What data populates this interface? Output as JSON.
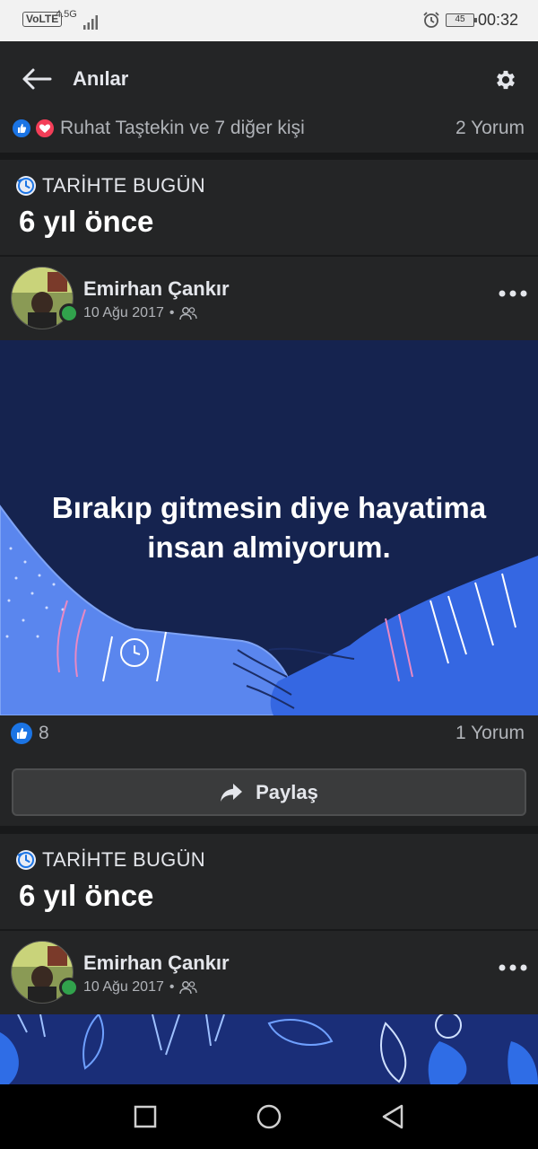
{
  "status_bar": {
    "volte": "VoLTE",
    "network": "4.5G",
    "battery": "45",
    "time": "00:32"
  },
  "header": {
    "title": "Anılar"
  },
  "summary": {
    "reactors": "Ruhat Taştekin ve 7 diğer kişi",
    "comments": "2 Yorum"
  },
  "memories": [
    {
      "section_label": "TARİHTE BUGÜN",
      "years_ago": "6 yıl önce",
      "author": "Emirhan Çankır",
      "date": "10 Ağu 2017",
      "separator": "•",
      "post_text": "Bırakıp gitmesin diye hayatima insan almiyorum.",
      "likes": "8",
      "comments": "1 Yorum",
      "share_label": "Paylaş"
    },
    {
      "section_label": "TARİHTE BUGÜN",
      "years_ago": "6 yıl önce",
      "author": "Emirhan Çankır",
      "date": "10 Ağu 2017",
      "separator": "•"
    }
  ],
  "colors": {
    "background": "#18191a",
    "card": "#242526",
    "accent_blue": "#1b74e4",
    "love_red": "#f33e58",
    "online_green": "#31a24c",
    "post_bg": "#15234f",
    "arm_blue": "#4f7fe8"
  },
  "icons": {
    "back": "arrow-left-icon",
    "settings": "gear-icon",
    "memory": "clock-history-icon",
    "audience": "friends-icon",
    "more": "ellipsis-icon",
    "share": "share-arrow-icon"
  }
}
